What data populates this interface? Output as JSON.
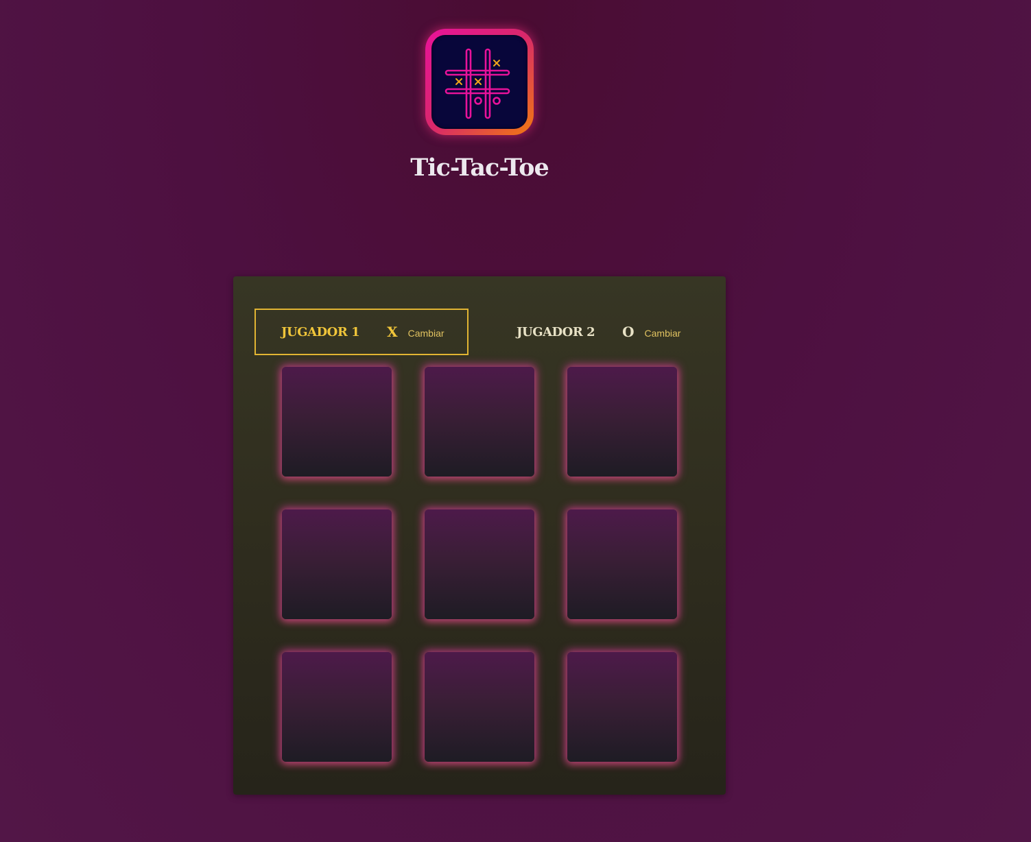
{
  "app": {
    "title": "Tic-Tac-Toe",
    "logo_icon": "tic-tac-toe-grid-icon"
  },
  "players": [
    {
      "name": "JUGADOR 1",
      "mark": "X",
      "change_label": "Cambiar",
      "active": true
    },
    {
      "name": "JUGADOR 2",
      "mark": "O",
      "change_label": "Cambiar",
      "active": false
    }
  ],
  "board": {
    "cells": [
      "",
      "",
      "",
      "",
      "",
      "",
      "",
      "",
      ""
    ]
  },
  "colors": {
    "accent": "#f0c53a",
    "neon_pink": "#e8129a",
    "neon_orange": "#f07a10",
    "background": "#4d1040",
    "panel": "#2f2d1e"
  }
}
